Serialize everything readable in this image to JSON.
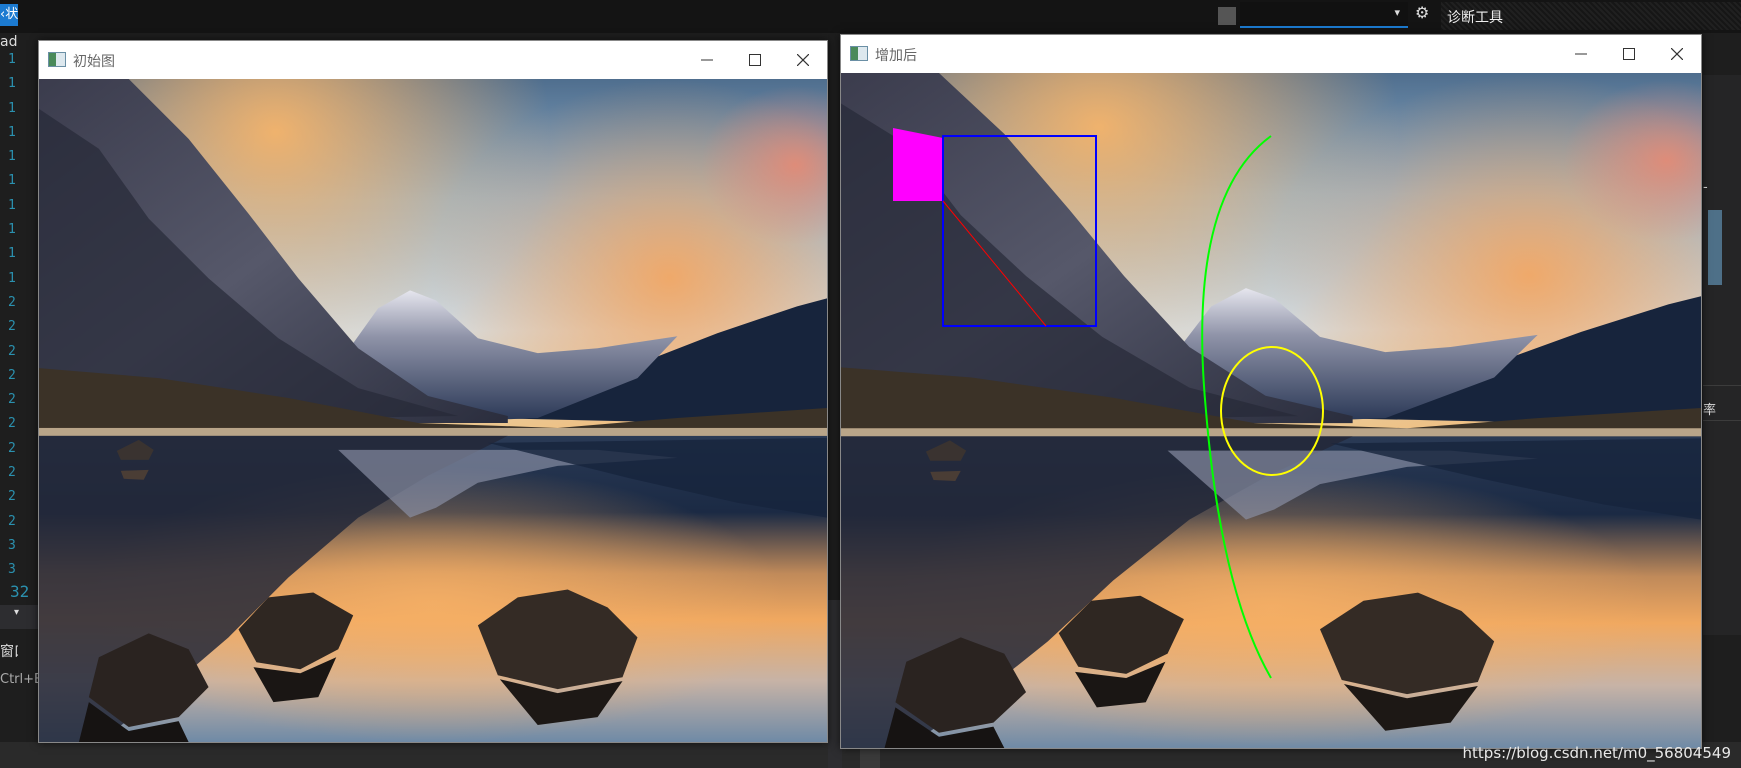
{
  "ide": {
    "tab_fragment": "‹状",
    "side_fragment": "ady",
    "line_numbers": "1\n1\n1\n1\n1\n1\n1\n1\n1\n1\n2\n2\n2\n2\n2\n2\n2\n2\n2\n2\n3\n3",
    "last_line_number": "32",
    "strip_arrow": "▾",
    "panel_label": "窗口",
    "shortcut_fragment": "Ctrl+E",
    "dropdown_arrow": "▾",
    "gear": "⚙",
    "diagnostics_label": "诊断工具",
    "right_rate": "率",
    "right_mark": "-"
  },
  "windows": {
    "original": {
      "title": "初始图",
      "minimize": "minimize-icon",
      "maximize": "maximize-icon",
      "close": "close-icon"
    },
    "annotated": {
      "title": "增加后",
      "minimize": "minimize-icon",
      "maximize": "maximize-icon",
      "close": "close-icon",
      "overlay_colors": {
        "polygon": "#ff00ff",
        "rectangle": "#0000ff",
        "line": "#ff0000",
        "ellipse": "#ffff00",
        "arc": "#00ff00"
      }
    }
  },
  "watermark": "https://blog.csdn.net/m0_56804549"
}
